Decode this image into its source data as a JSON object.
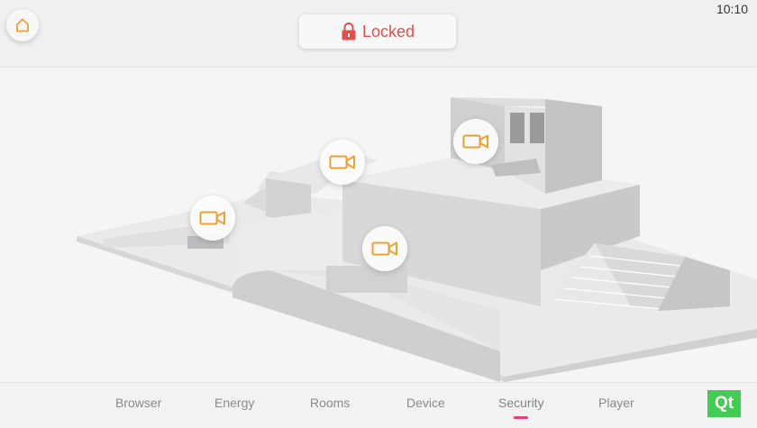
{
  "header": {
    "lock_status": "Locked",
    "clock": "10:10",
    "home_icon": "home-icon",
    "lock_icon": "padlock-icon"
  },
  "cameras": [
    {
      "name": "camera-1",
      "icon": "video-camera-icon"
    },
    {
      "name": "camera-2",
      "icon": "video-camera-icon"
    },
    {
      "name": "camera-3",
      "icon": "video-camera-icon"
    },
    {
      "name": "camera-4",
      "icon": "video-camera-icon"
    }
  ],
  "nav": {
    "items": [
      {
        "label": "Browser"
      },
      {
        "label": "Energy"
      },
      {
        "label": "Rooms"
      },
      {
        "label": "Device"
      },
      {
        "label": "Security"
      },
      {
        "label": "Player"
      }
    ],
    "active": "Security"
  },
  "logo": {
    "text": "Qt"
  },
  "colors": {
    "accent": "#f0a030",
    "locked": "#e1504a",
    "active_indicator": "#e8407a",
    "qt_green": "#41cd52"
  }
}
